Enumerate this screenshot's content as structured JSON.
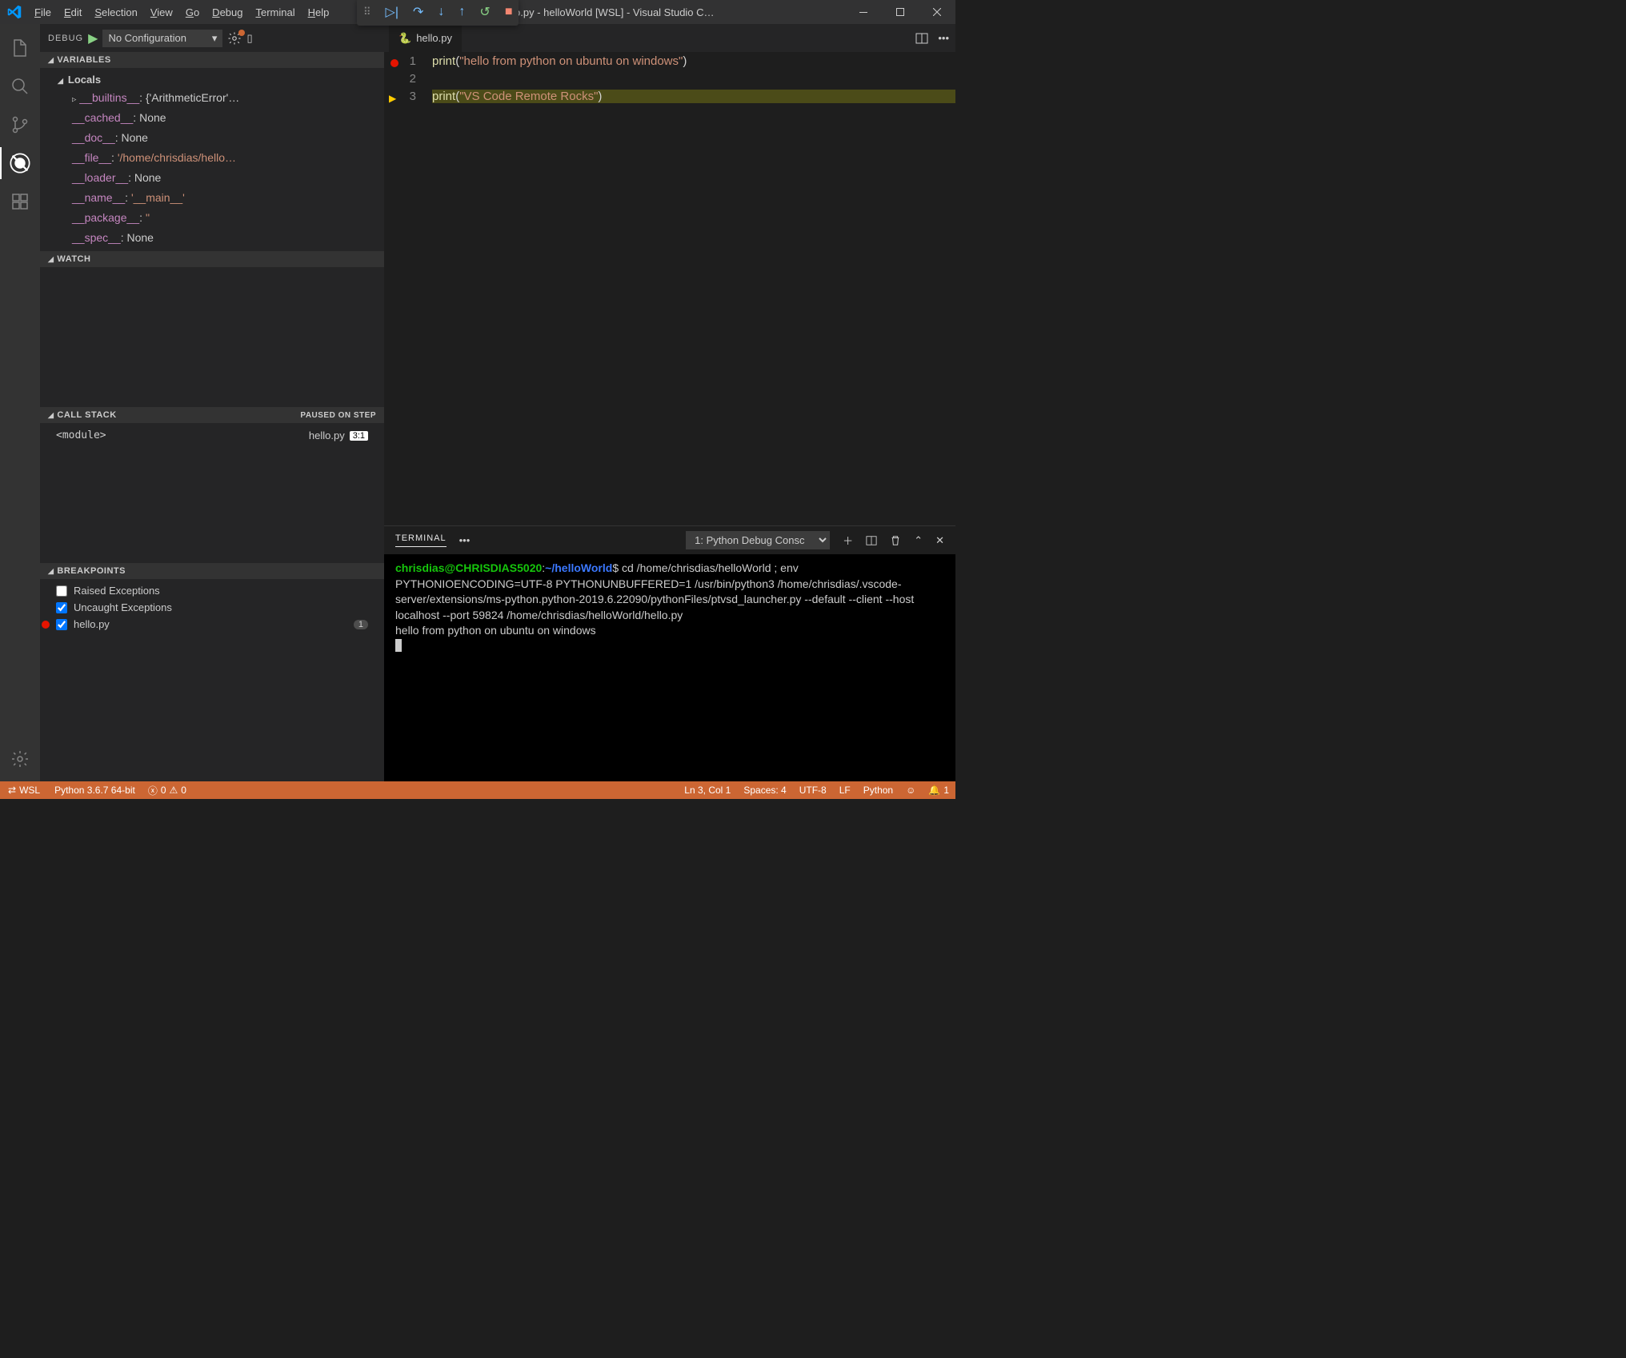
{
  "titlebar": {
    "title": "hello.py - helloWorld [WSL] - Visual Studio C…",
    "menu": [
      "File",
      "Edit",
      "Selection",
      "View",
      "Go",
      "Debug",
      "Terminal",
      "Help"
    ]
  },
  "debugHeader": {
    "label": "DEBUG",
    "config": "No Configuration",
    "dropdown": "▾"
  },
  "sections": {
    "variables": "VARIABLES",
    "watch": "WATCH",
    "callstack": "CALL STACK",
    "callstackStatus": "PAUSED ON STEP",
    "breakpoints": "BREAKPOINTS"
  },
  "variables": {
    "scope": "Locals",
    "items": [
      {
        "name": "__builtins__",
        "sep": ": ",
        "val": "{'ArithmeticError'…",
        "expandable": true,
        "str": false
      },
      {
        "name": "__cached__",
        "sep": ": ",
        "val": "None",
        "expandable": false,
        "str": false
      },
      {
        "name": "__doc__",
        "sep": ": ",
        "val": "None",
        "expandable": false,
        "str": false
      },
      {
        "name": "__file__",
        "sep": ": ",
        "val": "'/home/chrisdias/hello…",
        "expandable": false,
        "str": true
      },
      {
        "name": "__loader__",
        "sep": ": ",
        "val": "None",
        "expandable": false,
        "str": false
      },
      {
        "name": "__name__",
        "sep": ": ",
        "val": "'__main__'",
        "expandable": false,
        "str": true
      },
      {
        "name": "__package__",
        "sep": ": ",
        "val": "''",
        "expandable": false,
        "str": true
      },
      {
        "name": "__spec__",
        "sep": ": ",
        "val": "None",
        "expandable": false,
        "str": false
      }
    ]
  },
  "callstack": {
    "frame": "<module>",
    "file": "hello.py",
    "pos": "3:1"
  },
  "breakpoints": {
    "raised": "Raised Exceptions",
    "uncaught": "Uncaught Exceptions",
    "file": "hello.py",
    "count": "1"
  },
  "tabs": {
    "file": "hello.py"
  },
  "editor": {
    "lines": [
      {
        "n": "1",
        "bp": true,
        "arrow": false,
        "current": false,
        "fn": "print",
        "open": "(",
        "str": "\"hello from python on ubuntu on windows\"",
        "close": ")"
      },
      {
        "n": "2",
        "bp": false,
        "arrow": false,
        "current": false,
        "fn": "",
        "open": "",
        "str": "",
        "close": ""
      },
      {
        "n": "3",
        "bp": false,
        "arrow": true,
        "current": true,
        "fn": "print",
        "open": "(",
        "str": "\"VS Code Remote Rocks\"",
        "close": ")"
      }
    ]
  },
  "panel": {
    "tab": "TERMINAL",
    "select": "1: Python Debug Consc",
    "user": "chrisdias@CHRISDIAS5020",
    "colon": ":",
    "path": "~/helloWorld",
    "prompt": "$",
    "cmd": " cd /home/chrisdias/helloWorld ; env PYTHONIOENCODING=UTF-8 PYTHONUNBUFFERED=1 /usr/bin/python3 /home/chrisdias/.vscode-server/extensions/ms-python.python-2019.6.22090/pythonFiles/ptvsd_launcher.py --default --client --host localhost --port 59824 /home/chrisdias/helloWorld/hello.py",
    "output": "hello from python on ubuntu on windows"
  },
  "statusbar": {
    "remote": "WSL",
    "python": "Python 3.6.7 64-bit",
    "errors": "0",
    "warnings": "0",
    "lncol": "Ln 3, Col 1",
    "spaces": "Spaces: 4",
    "encoding": "UTF-8",
    "eol": "LF",
    "lang": "Python",
    "bell": "1"
  }
}
